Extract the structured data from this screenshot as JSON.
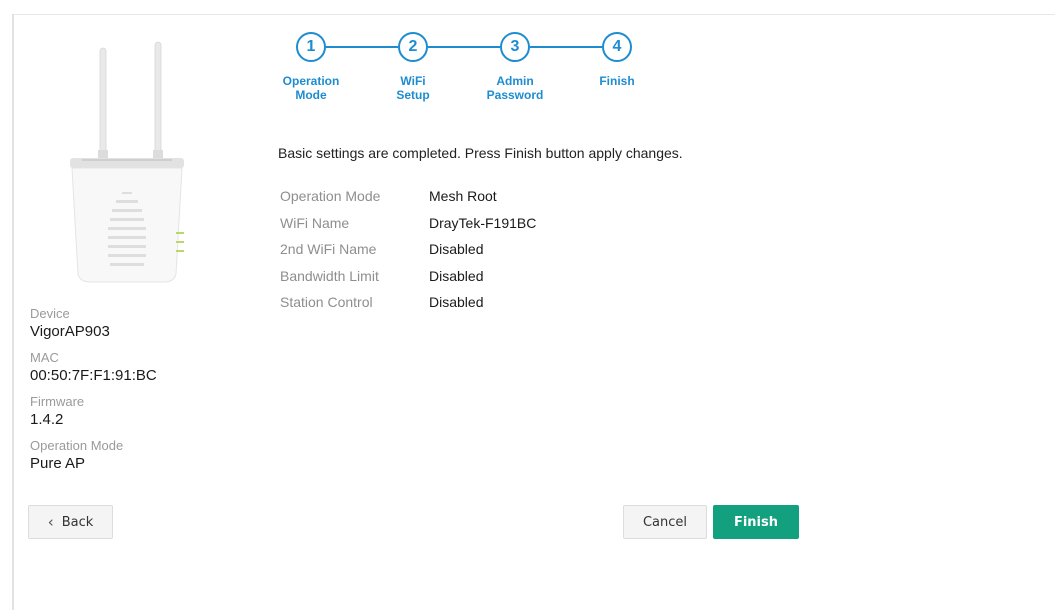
{
  "device_info": {
    "device_label": "Device",
    "device_value": "VigorAP903",
    "mac_label": "MAC",
    "mac_value": "00:50:7F:F1:91:BC",
    "firmware_label": "Firmware",
    "firmware_value": "1.4.2",
    "mode_label": "Operation Mode",
    "mode_value": "Pure AP"
  },
  "stepper": {
    "steps": [
      {
        "number": "1",
        "label_line1": "Operation",
        "label_line2": "Mode"
      },
      {
        "number": "2",
        "label_line1": "WiFi",
        "label_line2": "Setup"
      },
      {
        "number": "3",
        "label_line1": "Admin",
        "label_line2": "Password"
      },
      {
        "number": "4",
        "label_line1": "Finish",
        "label_line2": ""
      }
    ],
    "accent_color": "#1e8cd0"
  },
  "message": "Basic settings are completed. Press Finish button apply changes.",
  "summary": [
    {
      "key": "Operation Mode",
      "value": "Mesh Root"
    },
    {
      "key": "WiFi Name",
      "value": "DrayTek-F191BC"
    },
    {
      "key": "2nd WiFi Name",
      "value": "Disabled"
    },
    {
      "key": "Bandwidth Limit",
      "value": "Disabled"
    },
    {
      "key": "Station Control",
      "value": "Disabled"
    }
  ],
  "buttons": {
    "back_label": "Back",
    "back_icon": "chevron-left-icon",
    "cancel_label": "Cancel",
    "finish_label": "Finish",
    "finish_color": "#13a07f"
  }
}
